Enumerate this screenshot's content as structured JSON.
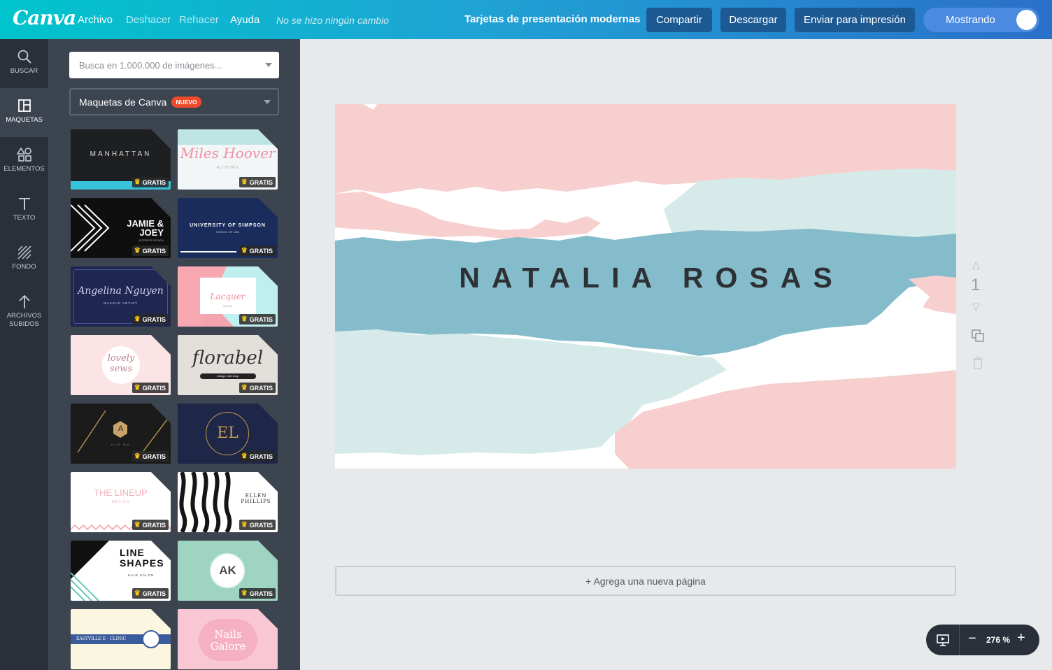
{
  "topbar": {
    "logo": "Canva",
    "menu": [
      "Archivo",
      "Deshacer",
      "Rehacer",
      "Ayuda"
    ],
    "status": "No se hizo ningún cambio",
    "doc_title": "Tarjetas de presentación modernas",
    "share": "Compartir",
    "download": "Descargar",
    "print": "Enviar para impresión",
    "toggle_label": "Mostrando"
  },
  "rail": {
    "items": [
      {
        "label": "BUSCAR",
        "icon": "search-icon"
      },
      {
        "label": "MAQUETAS",
        "icon": "layouts-icon"
      },
      {
        "label": "ELEMENTOS",
        "icon": "elements-icon"
      },
      {
        "label": "TEXTO",
        "icon": "text-icon"
      },
      {
        "label": "FONDO",
        "icon": "background-icon"
      },
      {
        "label": "ARCHIVOS SUBIDOS",
        "icon": "upload-icon"
      }
    ]
  },
  "panel": {
    "search_placeholder": "Busca en 1.000.000 de imágenes...",
    "select_label": "Maquetas de Canva",
    "select_badge": "NUEVO",
    "free_label": "GRATIS",
    "templates": [
      {
        "name": "MANHATTAN"
      },
      {
        "name": "Miles Hoover",
        "sub": "AUTHORS"
      },
      {
        "name": "JAMIE & JOEY",
        "sub": "INTERIOR DESIGN"
      },
      {
        "name": "UNIVERSITY OF SIMPSON",
        "sub": "SCHOOL OF LAW"
      },
      {
        "name": "Angelina Nguyen",
        "sub": "MAKEUP ARTIST"
      },
      {
        "name": "Lacquer",
        "sub": "SALON"
      },
      {
        "name": "lovely sews"
      },
      {
        "name": "florabel",
        "sub": "vintage craft shop"
      },
      {
        "name": "A",
        "sub": "ALW MA"
      },
      {
        "name": "EL"
      },
      {
        "name": "THE LINEUP",
        "sub": "MEXICO"
      },
      {
        "name": "ELLEN PHILLIPS"
      },
      {
        "name": "LINE SHAPES",
        "sub": "HAIR SALON"
      },
      {
        "name": "AK"
      },
      {
        "name": "EASTVILLE E - CLINIC"
      },
      {
        "name": "Nails Galore"
      }
    ]
  },
  "canvas": {
    "card_text": "NATALIA ROSAS",
    "page_number": "1",
    "add_page": "+ Agrega una nueva página",
    "zoom": "276 %"
  },
  "colors": {
    "pink": "#f6cfce",
    "blue": "#85bccb",
    "mint": "#d6ebe9",
    "dark": "#293039"
  }
}
